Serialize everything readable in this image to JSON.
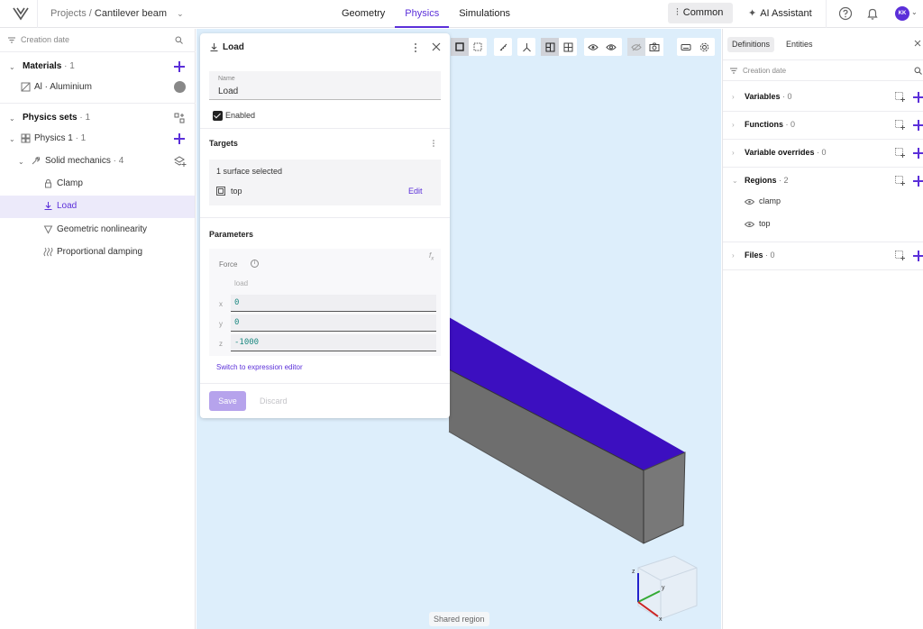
{
  "topbar": {
    "breadcrumb_root": "Projects /",
    "project_name": "Cantilever beam",
    "tabs": [
      {
        "label": "Geometry"
      },
      {
        "label": "Physics"
      },
      {
        "label": "Simulations"
      }
    ],
    "active_tab": "Physics",
    "common_label": "Common",
    "ai_label": "AI Assistant",
    "avatar_initials": "KK"
  },
  "sidebar": {
    "filter_label": "Creation date",
    "materials": {
      "title": "Materials",
      "count": "· 1"
    },
    "material_item": {
      "label": "Al · Aluminium"
    },
    "physics_sets": {
      "title": "Physics sets",
      "count": "· 1"
    },
    "physics1": {
      "label": "Physics 1",
      "count": "· 1"
    },
    "solid_mechanics": {
      "label": "Solid mechanics",
      "count": "· 4"
    },
    "items": [
      {
        "label": "Clamp"
      },
      {
        "label": "Load"
      },
      {
        "label": "Geometric nonlinearity"
      },
      {
        "label": "Proportional damping"
      }
    ]
  },
  "panel": {
    "title": "Load",
    "name_label": "Name",
    "name_value": "Load",
    "enabled_label": "Enabled",
    "enabled": true,
    "targets_title": "Targets",
    "targets_selected": "1 surface selected",
    "target_name": "top",
    "edit_label": "Edit",
    "parameters_title": "Parameters",
    "fx_label": "f",
    "force_label": "Force",
    "force_unit_placeholder": "load",
    "force": [
      {
        "axis": "x",
        "value": "0"
      },
      {
        "axis": "y",
        "value": "0"
      },
      {
        "axis": "z",
        "value": "-1000"
      }
    ],
    "switch_label": "Switch to expression editor",
    "save_label": "Save",
    "discard_label": "Discard"
  },
  "viewport": {
    "shared_region_label": "Shared region",
    "axes": {
      "z": "z",
      "y": "y",
      "x": "x"
    },
    "colors": {
      "beam_top": "#3c0fc0",
      "beam_side": "#6e6e6e",
      "background": "#ddeefb"
    }
  },
  "right_panel": {
    "tabs": [
      {
        "label": "Definitions"
      },
      {
        "label": "Entities"
      }
    ],
    "filter_label": "Creation date",
    "sections": [
      {
        "label": "Variables",
        "count": "· 0"
      },
      {
        "label": "Functions",
        "count": "· 0"
      },
      {
        "label": "Variable overrides",
        "count": "· 0"
      },
      {
        "label": "Regions",
        "count": "· 2"
      },
      {
        "label": "Files",
        "count": "· 0"
      }
    ],
    "regions": [
      {
        "label": "clamp"
      },
      {
        "label": "top"
      }
    ]
  },
  "colors": {
    "accent": "#5b2fd9",
    "selected_row": "#eceafa"
  }
}
